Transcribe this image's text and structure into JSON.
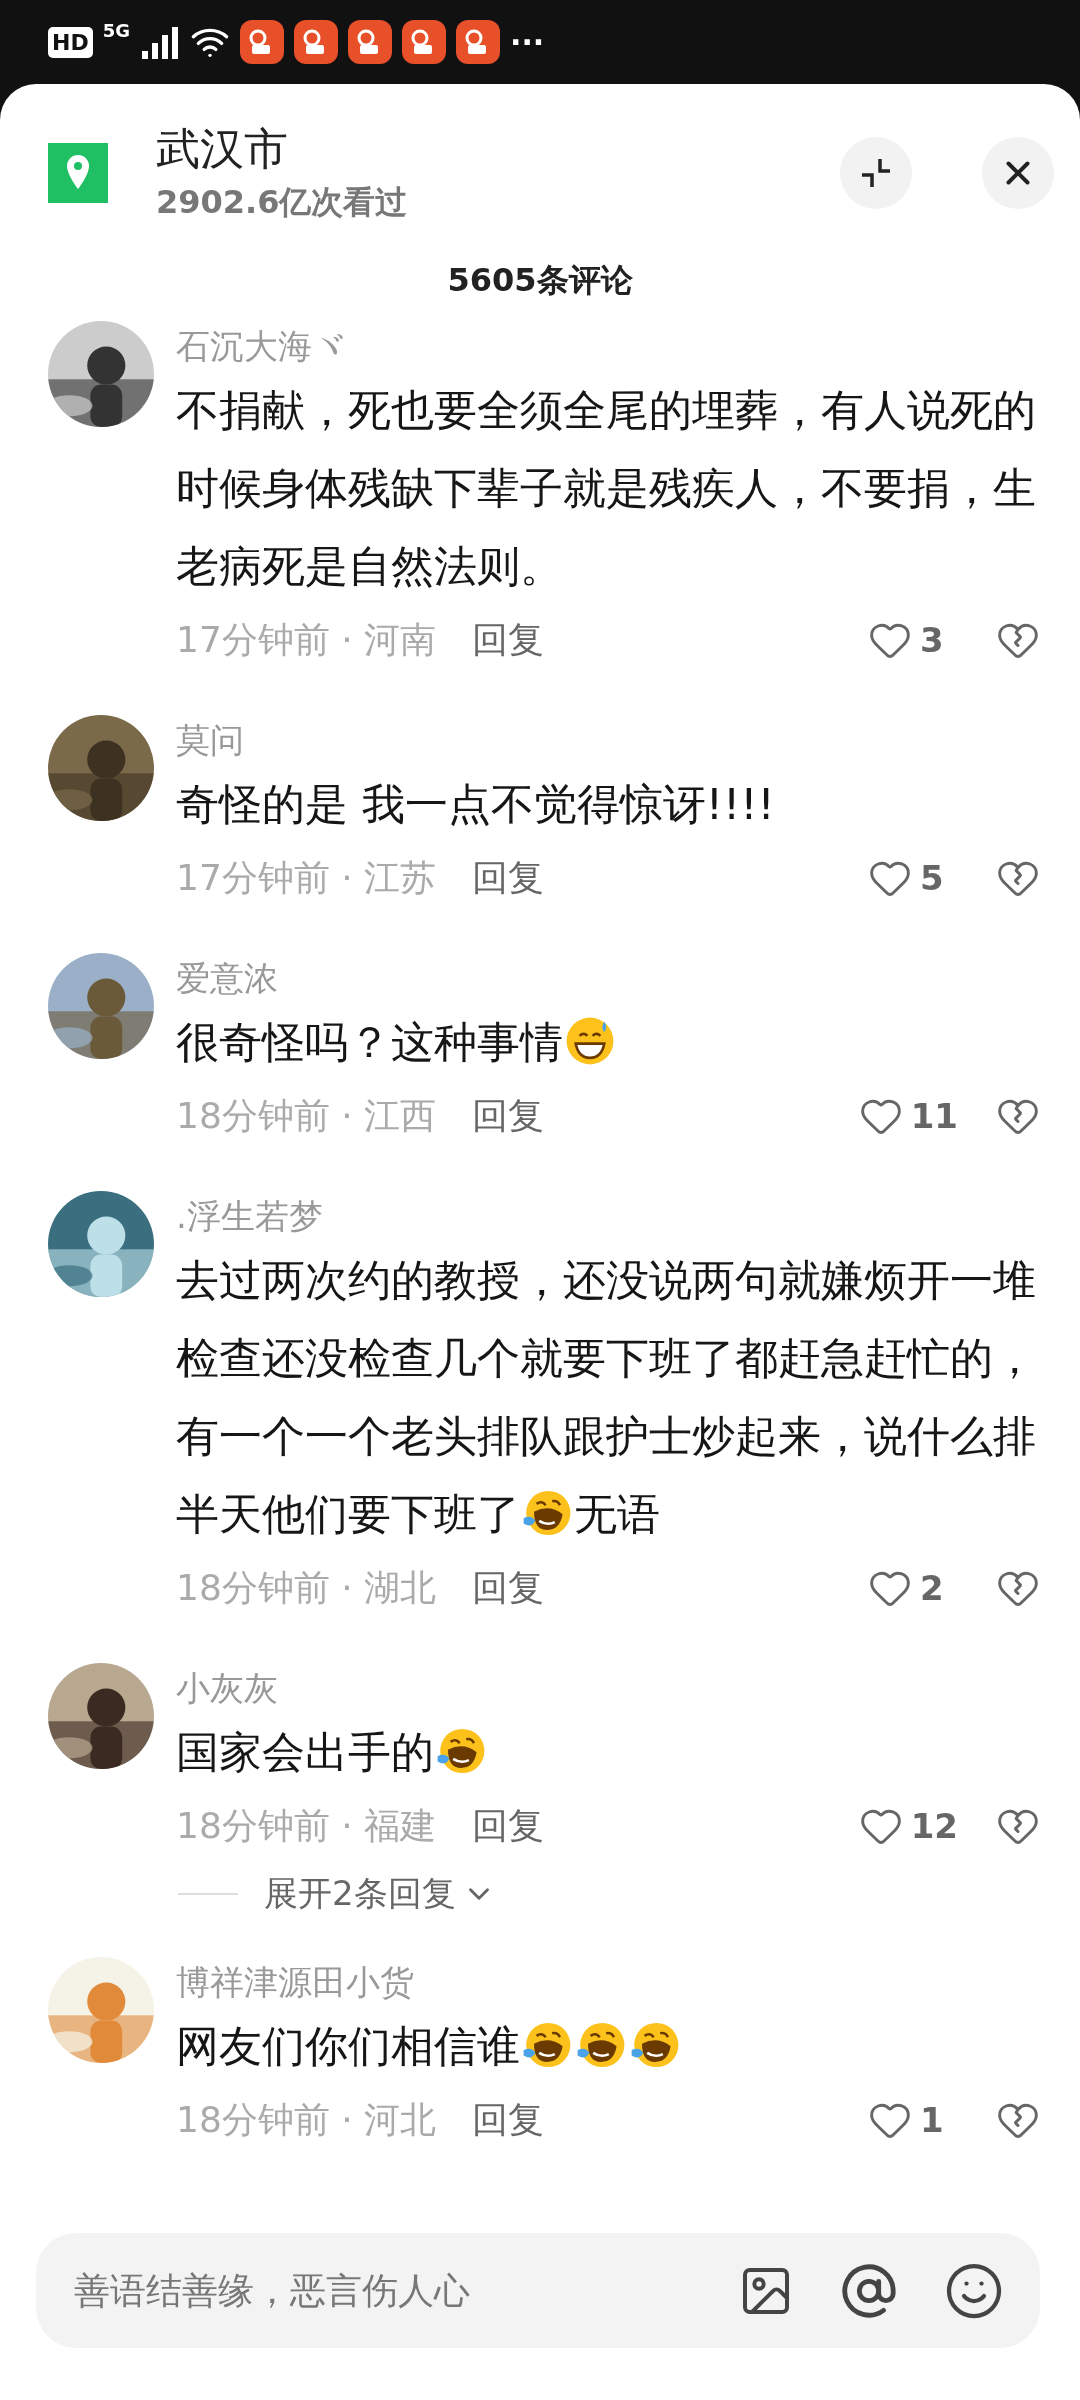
{
  "status_bar": {
    "hd": "HD",
    "network": "5G",
    "app_notifications": [
      {
        "kind": "video_app"
      },
      {
        "kind": "video_app"
      },
      {
        "kind": "video_app"
      },
      {
        "kind": "video_app"
      },
      {
        "kind": "video_app"
      }
    ],
    "more": "···"
  },
  "header": {
    "title": "武汉市",
    "views": "2902.6亿次看过"
  },
  "comment_count": "5605条评论",
  "comments": [
    {
      "name": "石沉大海ヾ",
      "body": [
        {
          "kind": "text",
          "text": "不捐献，死也要全须全尾的埋葬，有人说死的时候身体残缺下辈子就是残疾人，不要捐，生老病死是自然法则。"
        }
      ],
      "meta": "17分钟前 · 河南",
      "reply": "回复",
      "likes": "3"
    },
    {
      "name": "莫问",
      "body": [
        {
          "kind": "text",
          "text": "奇怪的是  我一点不觉得惊讶!!!!"
        }
      ],
      "meta": "17分钟前 · 江苏",
      "reply": "回复",
      "likes": "5"
    },
    {
      "name": "爱意浓",
      "body": [
        {
          "kind": "text",
          "text": "很奇怪吗？这种事情"
        },
        {
          "kind": "sweat_emoji"
        }
      ],
      "meta": "18分钟前 · 江西",
      "reply": "回复",
      "likes": "11"
    },
    {
      "name": ".浮生若梦",
      "body": [
        {
          "kind": "text",
          "text": "去过两次约的教授，还没说两句就嫌烦开一堆检查还没检查几个就要下班了都赶急赶忙的，有一个一个老头排队跟护士炒起来，说什么排半天他们要下班了"
        },
        {
          "kind": "tears_emoji"
        },
        {
          "kind": "text",
          "text": "无语"
        }
      ],
      "meta": "18分钟前 · 湖北",
      "reply": "回复",
      "likes": "2"
    },
    {
      "name": "小灰灰",
      "body": [
        {
          "kind": "text",
          "text": "国家会出手的"
        },
        {
          "kind": "tears_emoji"
        }
      ],
      "meta": "18分钟前 · 福建",
      "reply": "回复",
      "likes": "12",
      "expand": "展开2条回复"
    },
    {
      "name": "博祥津源田小货",
      "body": [
        {
          "kind": "text",
          "text": "网友们你们相信谁"
        },
        {
          "kind": "tears_emoji"
        },
        {
          "kind": "tears_emoji"
        },
        {
          "kind": "tears_emoji"
        }
      ],
      "meta": "18分钟前 · 河北",
      "reply": "回复",
      "likes": "1"
    }
  ],
  "input": {
    "placeholder": "善语结善缘，恶言伤人心"
  }
}
